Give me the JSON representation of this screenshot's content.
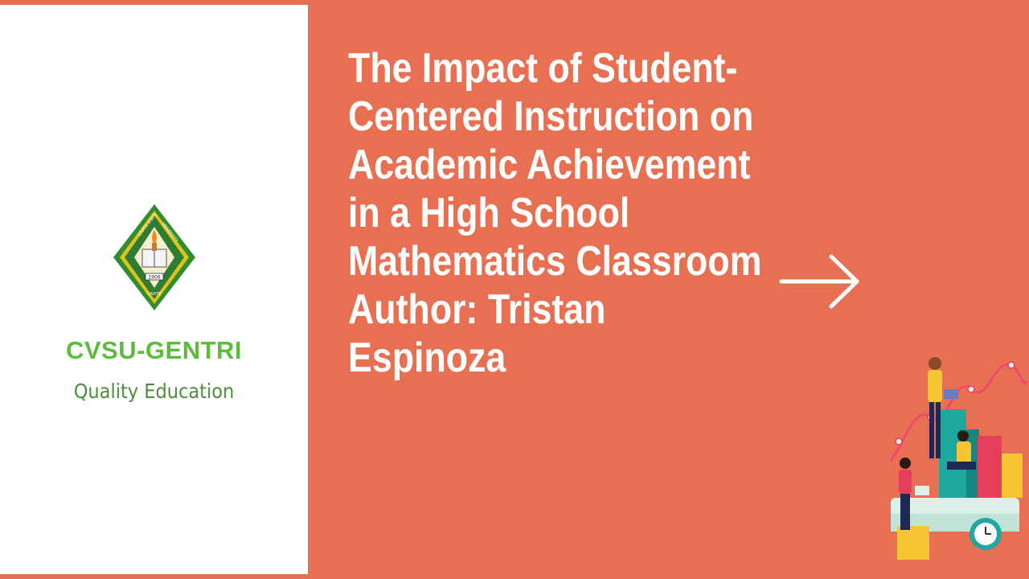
{
  "left_panel": {
    "org_name": "CVSU-GENTRI",
    "tagline": "Quality Education",
    "logo": {
      "year_text": "1906",
      "top_text": "CAVITE STATE",
      "right_text": "UNIVERSITY",
      "bottom_text": "CAVITE",
      "colors": {
        "green": "#2F8F2F",
        "gold": "#E1C21A"
      }
    }
  },
  "title": {
    "lines": [
      "The Impact of Student-",
      "Centered Instruction on",
      "Academic Achievement",
      "in a High School",
      "Mathematics Classroom",
      "Author: Tristan",
      "Espinoza"
    ]
  },
  "colors": {
    "background": "#E77052",
    "panel": "#FFFFFF",
    "org_green": "#5DBB3E",
    "tagline_green": "#4A8F3A"
  },
  "icons": {
    "arrow": "right-arrow-icon",
    "illustration": "students-with-charts-illustration"
  }
}
